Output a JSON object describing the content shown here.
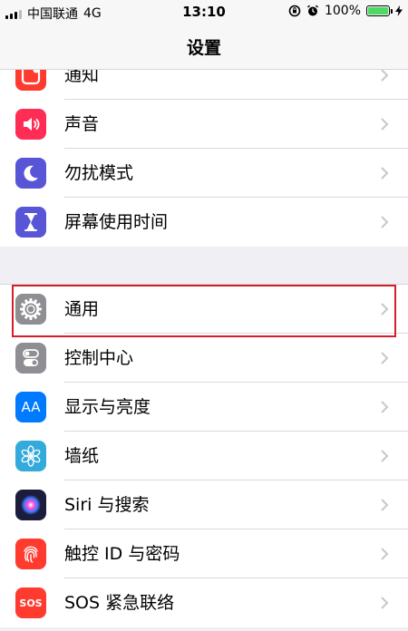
{
  "status_bar": {
    "carrier": "中国联通",
    "network": "4G",
    "time": "13:10",
    "battery": "100%",
    "battery_level": 1.0
  },
  "nav": {
    "title": "设置"
  },
  "groups": [
    {
      "items": [
        {
          "label": "通知",
          "icon": "notifications-icon",
          "color": "#ff3b30"
        },
        {
          "label": "声音",
          "icon": "sounds-icon",
          "color": "#ff2d55"
        },
        {
          "label": "勿扰模式",
          "icon": "moon-icon",
          "color": "#5856d6"
        },
        {
          "label": "屏幕使用时间",
          "icon": "hourglass-icon",
          "color": "#5856d6"
        }
      ]
    },
    {
      "items": [
        {
          "label": "通用",
          "icon": "gear-icon",
          "color": "#8e8e93"
        },
        {
          "label": "控制中心",
          "icon": "toggles-icon",
          "color": "#8e8e93"
        },
        {
          "label": "显示与亮度",
          "icon": "aa-icon",
          "color": "#007aff",
          "icon_text": "AA"
        },
        {
          "label": "墙纸",
          "icon": "flower-icon",
          "color": "#34aadc"
        },
        {
          "label": "Siri 与搜索",
          "icon": "siri-icon",
          "color": "#1c1c3c"
        },
        {
          "label": "触控 ID 与密码",
          "icon": "fingerprint-icon",
          "color": "#ff3b30"
        },
        {
          "label": "SOS 紧急联络",
          "icon": "sos-icon",
          "color": "#ff3b30",
          "icon_text": "SOS"
        }
      ]
    }
  ]
}
